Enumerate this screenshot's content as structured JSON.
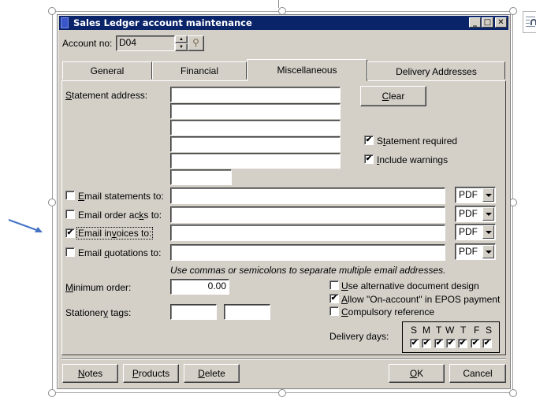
{
  "window": {
    "title": "Sales Ledger account maintenance",
    "controls": {
      "minimize": "_",
      "maximize": "□",
      "close": "✕"
    }
  },
  "account": {
    "label": "Account no:",
    "value": "D04",
    "search_icon": "binoculars-icon"
  },
  "tabs": [
    {
      "label": "General",
      "active": false
    },
    {
      "label": "Financial",
      "active": false
    },
    {
      "label": "Miscellaneous",
      "active": true
    },
    {
      "label": "Delivery Addresses",
      "active": false
    }
  ],
  "statement": {
    "label_first": "S",
    "label_rest": "tatement address:",
    "lines": [
      "",
      "",
      "",
      "",
      "",
      ""
    ],
    "clear_first": "C",
    "clear_rest": "lear",
    "statement_required": {
      "pre": "S",
      "u": "t",
      "post": "atement required",
      "checked": true
    },
    "include_warnings": {
      "pre": "",
      "u": "I",
      "post": "nclude warnings",
      "checked": true
    }
  },
  "emails": [
    {
      "pre": "",
      "u": "E",
      "post": "mail statements to:",
      "checked": false,
      "value": "",
      "format": "PDF"
    },
    {
      "pre": "Email order ac",
      "u": "k",
      "post": "s to:",
      "checked": false,
      "value": "",
      "format": "PDF"
    },
    {
      "pre": "Email in",
      "u": "v",
      "post": "oices to:",
      "checked": true,
      "value": "",
      "format": "PDF"
    },
    {
      "pre": "Email ",
      "u": "q",
      "post": "uotations to:",
      "checked": false,
      "value": "",
      "format": "PDF"
    }
  ],
  "email_hint": "Use commas or semicolons to separate multiple email addresses.",
  "minimum_order": {
    "u": "M",
    "post": "inimum order:",
    "value": "0.00"
  },
  "stationery": {
    "pre": "Stationer",
    "u": "y",
    "post": " tags:",
    "value1": "",
    "value2": ""
  },
  "options": [
    {
      "pre": "",
      "u": "U",
      "post": "se alternative document design",
      "checked": false
    },
    {
      "pre": "",
      "u": "A",
      "post": "llow \"On-account\" in EPOS payment",
      "checked": true
    },
    {
      "pre": "",
      "u": "C",
      "post": "ompulsory reference",
      "checked": false
    }
  ],
  "delivery_days": {
    "label": "Delivery days:",
    "days": [
      {
        "letter": "S",
        "checked": true
      },
      {
        "letter": "M",
        "checked": true
      },
      {
        "letter": "T",
        "checked": true
      },
      {
        "letter": "W",
        "checked": true
      },
      {
        "letter": "T",
        "checked": true
      },
      {
        "letter": "F",
        "checked": true
      },
      {
        "letter": "S",
        "checked": true
      }
    ]
  },
  "footer": {
    "notes": {
      "u": "N",
      "post": "otes"
    },
    "products": {
      "u": "P",
      "post": "roducts"
    },
    "delete": {
      "u": "D",
      "post": "elete"
    },
    "ok": {
      "u": "O",
      "post": "K"
    },
    "cancel": "Cancel"
  },
  "check_glyph": "✔",
  "arrow_color": "#4472c4"
}
